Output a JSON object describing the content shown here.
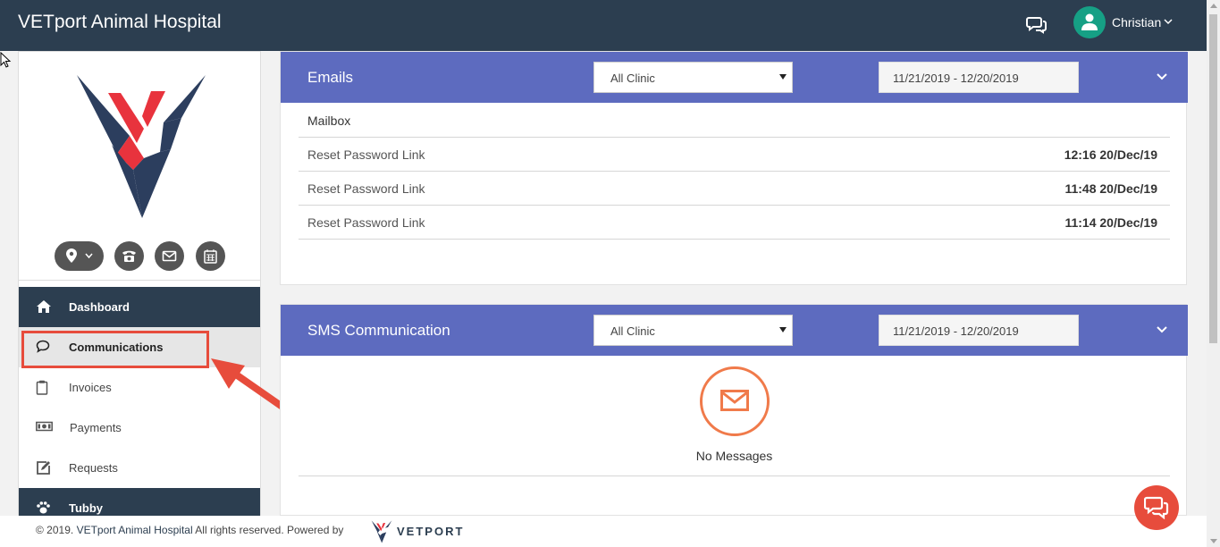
{
  "header": {
    "app_title": "VETport Animal Hospital",
    "user_name": "Christian"
  },
  "sidebar": {
    "quick_icons": [
      "location-icon",
      "phone-icon",
      "mail-icon",
      "calendar-icon"
    ],
    "items": [
      {
        "label": "Dashboard",
        "icon": "home-icon",
        "state": "dark"
      },
      {
        "label": "Communications",
        "icon": "chat-bubble-icon",
        "state": "active"
      },
      {
        "label": "Invoices",
        "icon": "clipboard-icon",
        "state": "normal"
      },
      {
        "label": "Payments",
        "icon": "money-icon",
        "state": "normal"
      },
      {
        "label": "Requests",
        "icon": "edit-icon",
        "state": "normal"
      },
      {
        "label": "Tubby",
        "icon": "paw-icon",
        "state": "dark"
      }
    ]
  },
  "emails": {
    "title": "Emails",
    "clinic_select": "All Clinic",
    "date_range": "11/21/2019 - 12/20/2019",
    "mailbox_label": "Mailbox",
    "rows": [
      {
        "subject": "Reset Password Link",
        "time": "12:16 20/Dec/19"
      },
      {
        "subject": "Reset Password Link",
        "time": "11:48 20/Dec/19"
      },
      {
        "subject": "Reset Password Link",
        "time": "11:14 20/Dec/19"
      }
    ]
  },
  "sms": {
    "title": "SMS Communication",
    "clinic_select": "All Clinic",
    "date_range": "11/21/2019 - 12/20/2019",
    "empty_text": "No Messages"
  },
  "footer": {
    "copyright": "© 2019.",
    "brand": "VETport Animal Hospital",
    "rights": "All rights reserved. Powered by",
    "vendor": "VETPORT"
  },
  "colors": {
    "topbar": "#2c3e50",
    "panel_header": "#5d6bbf",
    "accent_orange": "#f07a4a",
    "annotation_red": "#e74c3c",
    "avatar": "#16a085"
  }
}
